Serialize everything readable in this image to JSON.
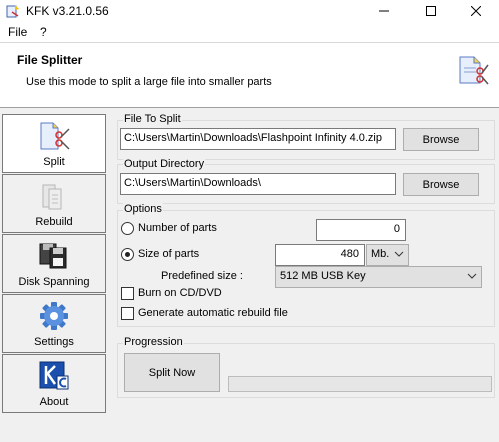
{
  "window": {
    "title": "KFK v3.21.0.56"
  },
  "menu": {
    "items": [
      "File",
      "?"
    ]
  },
  "header": {
    "title": "File Splitter",
    "description": "Use this mode to split a large file into smaller parts"
  },
  "sidebar": {
    "items": [
      {
        "label": "Split",
        "active": true
      },
      {
        "label": "Rebuild",
        "active": false
      },
      {
        "label": "Disk Spanning",
        "active": false
      },
      {
        "label": "Settings",
        "active": false
      },
      {
        "label": "About",
        "active": false
      }
    ]
  },
  "file_to_split": {
    "group_label": "File To Split",
    "value": "C:\\Users\\Martin\\Downloads\\Flashpoint Infinity 4.0.zip",
    "browse_label": "Browse"
  },
  "output_directory": {
    "group_label": "Output Directory",
    "value": "C:\\Users\\Martin\\Downloads\\",
    "browse_label": "Browse"
  },
  "options": {
    "group_label": "Options",
    "number_of_parts_label": "Number of parts",
    "number_of_parts_value": "0",
    "size_of_parts_label": "Size of parts",
    "size_of_parts_value": "480",
    "size_unit": "Mb.",
    "predefined_size_label": "Predefined size :",
    "predefined_size_value": "512 MB USB Key",
    "burn_label": "Burn on CD/DVD",
    "rebuild_file_label": "Generate automatic rebuild file",
    "selected_mode": "size_of_parts",
    "burn_checked": false,
    "rebuild_checked": false
  },
  "progression": {
    "group_label": "Progression",
    "split_button_label": "Split Now",
    "progress": 0
  },
  "colors": {
    "accent": "#0066cc",
    "progress_fill": "#06b025"
  }
}
